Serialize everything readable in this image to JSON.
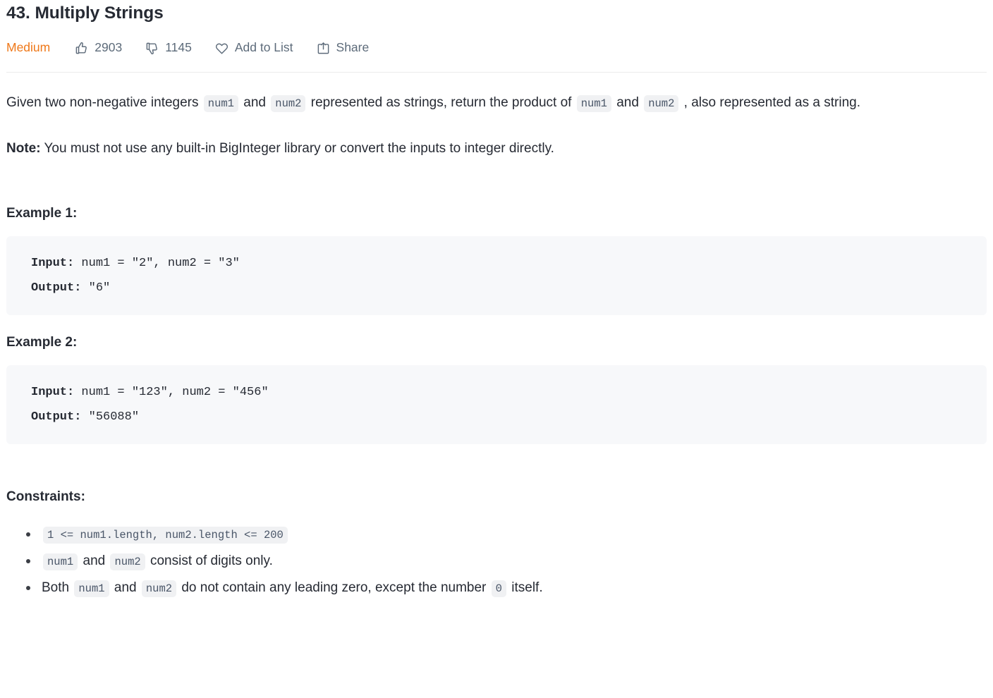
{
  "problem": {
    "title": "43. Multiply Strings",
    "difficulty": "Medium",
    "difficulty_color": "#ef7819"
  },
  "meta": {
    "likes": "2903",
    "dislikes": "1145",
    "add_to_list": "Add to List",
    "share": "Share",
    "icons": {
      "like": "thumbs-up-icon",
      "dislike": "thumbs-down-icon",
      "add_to_list": "heart-icon",
      "share": "share-icon"
    }
  },
  "description": {
    "line1_a": "Given two non-negative integers ",
    "code_num1_a": "num1",
    "line1_b": " and ",
    "code_num2_a": "num2",
    "line1_c": " represented as strings, return the product of ",
    "code_num1_b": "num1",
    "line1_d": " and ",
    "code_num2_b": "num2",
    "line1_e": " , also represented as a string.",
    "note_label": "Note:",
    "note_text": " You must not use any built-in BigInteger library or convert the inputs to integer directly."
  },
  "examples": [
    {
      "heading": "Example 1:",
      "input_label": "Input:",
      "input_value": " num1 = \"2\", num2 = \"3\"",
      "output_label": "Output:",
      "output_value": " \"6\""
    },
    {
      "heading": "Example 2:",
      "input_label": "Input:",
      "input_value": " num1 = \"123\", num2 = \"456\"",
      "output_label": "Output:",
      "output_value": " \"56088\""
    }
  ],
  "constraints": {
    "heading": "Constraints:",
    "items": [
      {
        "code_full": "1 <= num1.length, num2.length <= 200"
      },
      {
        "code_a": "num1",
        "text_a": " and ",
        "code_b": "num2",
        "text_b": " consist of digits only."
      },
      {
        "text_pre": "Both ",
        "code_a": "num1",
        "text_a": " and ",
        "code_b": "num2",
        "text_b": " do not contain any leading zero, except the number ",
        "code_c": "0",
        "text_c": " itself."
      }
    ]
  }
}
